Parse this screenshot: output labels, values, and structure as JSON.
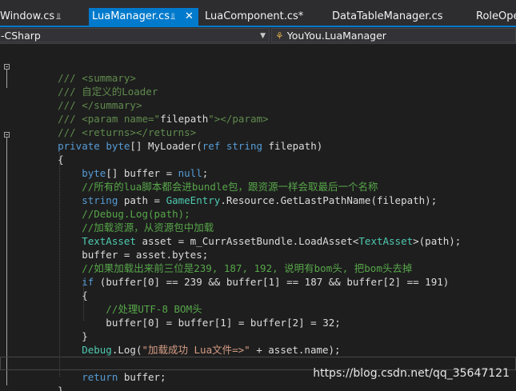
{
  "tabs": [
    {
      "label": "Window.cs",
      "icon": "pin-icon",
      "active": false
    },
    {
      "label": "LuaManager.cs",
      "icon": "pin-icon",
      "active": true
    },
    {
      "label": "LuaComponent.cs*",
      "active": false
    },
    {
      "label": "DataTableManager.cs",
      "active": false
    },
    {
      "label": "RoleOpe",
      "active": false
    }
  ],
  "nav": {
    "project": "-CSharp",
    "type": "YouYou.LuaManager",
    "type_icon": "class-icon"
  },
  "colors": {
    "keyword": "#569cd6",
    "type": "#4ec9b0",
    "comment": "#57a64a",
    "doc_tag": "#608b4e",
    "doc_prefix": "#608b4e",
    "string": "#d69d85",
    "text": "#dcdcdc",
    "accent": "#007acc"
  },
  "code": [
    [],
    [
      [
        "dc",
        "    /// "
      ],
      [
        "dt",
        "<summary>"
      ]
    ],
    [
      [
        "dc",
        "    /// 自定义的Loader"
      ]
    ],
    [
      [
        "dc",
        "    /// "
      ],
      [
        "dt",
        "</summary>"
      ]
    ],
    [
      [
        "dc",
        "    /// "
      ],
      [
        "dt",
        "<param name=\""
      ],
      [
        "pl",
        "filepath"
      ],
      [
        "dt",
        "\"></param>"
      ]
    ],
    [
      [
        "dc",
        "    /// "
      ],
      [
        "dt",
        "<returns></returns>"
      ]
    ],
    [
      [
        "kw",
        "    private "
      ],
      [
        "kw",
        "byte"
      ],
      [
        "pl",
        "[] MyLoader("
      ],
      [
        "kw",
        "ref "
      ],
      [
        "kw",
        "string"
      ],
      [
        "pl",
        " filepath)"
      ]
    ],
    [
      [
        "pl",
        "    {"
      ]
    ],
    [
      [
        "kw",
        "        byte"
      ],
      [
        "pl",
        "[] buffer = "
      ],
      [
        "kw",
        "null"
      ],
      [
        "pl",
        ";"
      ]
    ],
    [
      [
        "cm",
        "        //所有的lua脚本都会进bundle包，跟资源一样会取最后一个名称"
      ]
    ],
    [
      [
        "kw",
        "        string"
      ],
      [
        "pl",
        " path = "
      ],
      [
        "ty",
        "GameEntry"
      ],
      [
        "pl",
        ".Resource.GetLastPathName(filepath);"
      ]
    ],
    [
      [
        "cm",
        "        //Debug.Log(path);"
      ]
    ],
    [
      [
        "cm",
        "        //加载资源，从资源包中加载"
      ]
    ],
    [
      [
        "ty",
        "        TextAsset"
      ],
      [
        "pl",
        " asset = m_CurrAssetBundle.LoadAsset<"
      ],
      [
        "ty",
        "TextAsset"
      ],
      [
        "pl",
        ">(path);"
      ]
    ],
    [
      [
        "pl",
        "        buffer = asset.bytes;"
      ]
    ],
    [
      [
        "cm",
        "        //如果加载出来前三位是239, 187, 192, 说明有bom头, 把bom头去掉"
      ]
    ],
    [
      [
        "kw",
        "        if"
      ],
      [
        "pl",
        " (buffer[0] == 239 && buffer[1] == 187 && buffer[2] == 191)"
      ]
    ],
    [
      [
        "pl",
        "        {"
      ]
    ],
    [
      [
        "cm",
        "            //处理UTF-8 BOM头"
      ]
    ],
    [
      [
        "pl",
        "            buffer[0] = buffer[1] = buffer[2] = 32;"
      ]
    ],
    [
      [
        "pl",
        "        }"
      ]
    ],
    [
      [
        "ty",
        "        Debug"
      ],
      [
        "pl",
        ".Log("
      ],
      [
        "st",
        "\"加载成功 Lua文件=>\""
      ],
      [
        "pl",
        " + asset.name);"
      ]
    ],
    [],
    [
      [
        "kw",
        "        return"
      ],
      [
        "pl",
        " buffer;"
      ]
    ],
    [
      [
        "pl",
        "    }"
      ]
    ]
  ],
  "watermark": "https://blog.csdn.net/qq_35647121"
}
